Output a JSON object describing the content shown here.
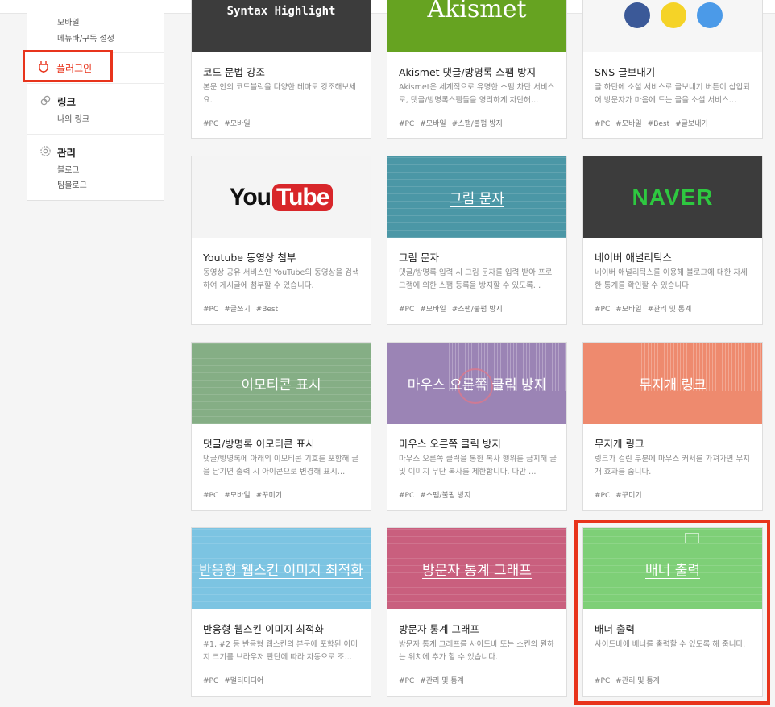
{
  "sidebar": {
    "mobile": "모바일",
    "menubar": "메뉴바/구독 설정",
    "plugin": "플러그인",
    "link_title": "링크",
    "my_link": "나의 링크",
    "manage_title": "관리",
    "blog": "블로그",
    "teamblog": "팀블로그"
  },
  "cards": [
    {
      "thumb": "Syntax Highlight",
      "name": "코드 문법 강조",
      "desc": "본문 안의 코드블럭을 다양한 테마로 강조해보세요.",
      "tags": [
        "#PC",
        "#모바일"
      ],
      "bg": "#3c3c3c"
    },
    {
      "thumb": "Akismet",
      "name": "Akismet 댓글/방명록 스팸 방지",
      "desc": "Akismet은 세계적으로 유명한 스팸 차단 서비스로, 댓글/방명록스팸들을 영리하게 차단해…",
      "tags": [
        "#PC",
        "#모바일",
        "#스팸/불펌 방지"
      ],
      "bg": "#66a321"
    },
    {
      "thumb": "",
      "name": "SNS 글보내기",
      "desc": "글 하단에 소셜 서비스로 글보내기 버튼이 삽입되어 방문자가 마음에 드는 글을 소셜 서비스…",
      "tags": [
        "#PC",
        "#모바일",
        "#Best",
        "#글보내기"
      ],
      "bg": "#f6f6f6"
    },
    {
      "thumb": "YouTube",
      "name": "Youtube 동영상 첨부",
      "desc": "동영상 공유 서비스인 YouTube의 동영상을 검색하여 게시글에 첨부할 수 있습니다.",
      "tags": [
        "#PC",
        "#글쓰기",
        "#Best"
      ],
      "bg": "#f4f4f4"
    },
    {
      "thumb": "그림 문자",
      "name": "그림 문자",
      "desc": "댓글/방명록 입력 시 그림 문자를 입력 받아 프로그램에 의한 스팸 등록을 방지할 수 있도록…",
      "tags": [
        "#PC",
        "#모바일",
        "#스팸/불펌 방지"
      ],
      "bg": "#4b97a6"
    },
    {
      "thumb": "NAVER",
      "name": "네이버 애널리틱스",
      "desc": "네이버 애널리틱스를 이용해 블로그에 대한 자세한 통계를 확인할 수 있습니다.",
      "tags": [
        "#PC",
        "#모바일",
        "#관리 및 통계"
      ],
      "bg": "#3c3c3c"
    },
    {
      "thumb": "이모티콘 표시",
      "name": "댓글/방명록 이모티콘 표시",
      "desc": "댓글/방명록에 아래의 이모티콘 기호를 포함해 글을 남기면 출력 시 아이콘으로 변경해 표시…",
      "tags": [
        "#PC",
        "#모바일",
        "#꾸미기"
      ],
      "bg": "#85ae85"
    },
    {
      "thumb": "마우스 오른쪽 클릭 방지",
      "name": "마우스 오른쪽 클릭 방지",
      "desc": "마우스 오른쪽 클릭을 통한 복사 행위를 금지해 글 및 이미지 무단 복사를 제한합니다. 다만 …",
      "tags": [
        "#PC",
        "#스팸/불펌 방지"
      ],
      "bg": "#9b84b5"
    },
    {
      "thumb": "무지개 링크",
      "name": "무지개 링크",
      "desc": "링크가 걸린 부분에 마우스 커서를 가져가면 무지개 효과를 줍니다.",
      "tags": [
        "#PC",
        "#꾸미기"
      ],
      "bg": "#ee8a6e"
    },
    {
      "thumb": "반응형 웹스킨 이미지 최적화",
      "name": "반응형 웹스킨 이미지 최적화",
      "desc": "#1, #2 등 반응형 웹스킨의 본문에 포함된 이미지 크기를 브라우저 판단에 따라 자동으로 조…",
      "tags": [
        "#PC",
        "#멀티미디어"
      ],
      "bg": "#7cc4e2"
    },
    {
      "thumb": "방문자 통계 그래프",
      "name": "방문자 통계 그래프",
      "desc": "방문자 통계 그래프를 사이드바 또는 스킨의 원하는 위치에 추가 할 수 있습니다.",
      "tags": [
        "#PC",
        "#관리 및 통계"
      ],
      "bg": "#c95f7e"
    },
    {
      "thumb": "배너 출력",
      "name": "배너 출력",
      "desc": "사이드바에 배너를 출력할 수 있도록 해 줍니다.",
      "tags": [
        "#PC",
        "#관리 및 통계"
      ],
      "bg": "#7ecf77"
    }
  ]
}
